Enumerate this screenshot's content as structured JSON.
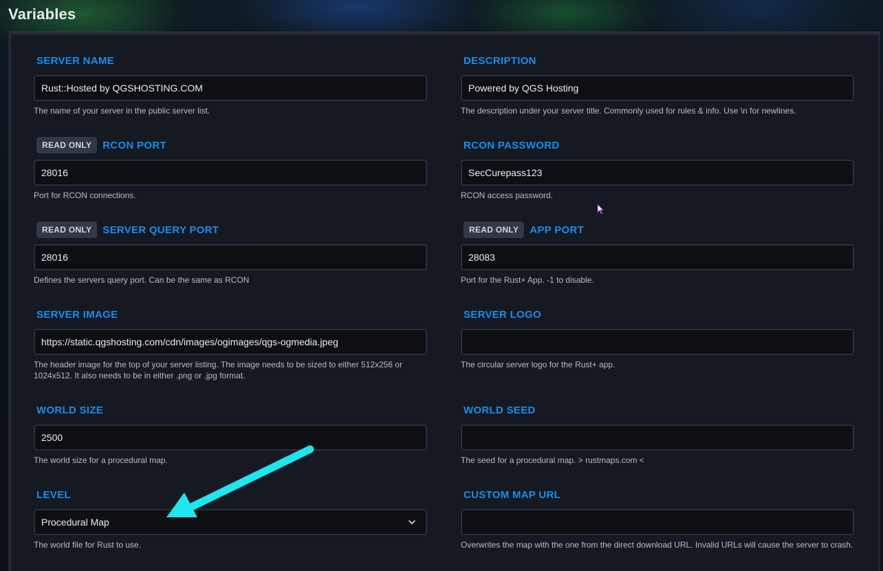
{
  "page": {
    "title": "Variables"
  },
  "accent_color": "#1c8cec",
  "annotation_color": "#1ee6ee",
  "badge_label": "READ ONLY",
  "fields": {
    "server_name": {
      "label": "SERVER NAME",
      "value": "Rust::Hosted by QGSHOSTING.COM",
      "description": "The name of your server in the public server list."
    },
    "description": {
      "label": "DESCRIPTION",
      "value": "Powered by QGS Hosting",
      "description": "The description under your server title. Commonly used for rules & info. Use \\n for newlines."
    },
    "rcon_port": {
      "label": "RCON PORT",
      "value": "28016",
      "description": "Port for RCON connections."
    },
    "rcon_password": {
      "label": "RCON PASSWORD",
      "value": "SecCurepass123",
      "description": "RCON access password."
    },
    "server_query_port": {
      "label": "SERVER QUERY PORT",
      "value": "28016",
      "description": "Defines the servers query port. Can be the same as RCON"
    },
    "app_port": {
      "label": "APP PORT",
      "value": "28083",
      "description": "Port for the Rust+ App. -1 to disable."
    },
    "server_image": {
      "label": "SERVER IMAGE",
      "value": "https://static.qgshosting.com/cdn/images/ogimages/qgs-ogmedia.jpeg",
      "description": "The header image for the top of your server listing. The image needs to be sized to either 512x256 or 1024x512. It also needs to be in either .png or .jpg format."
    },
    "server_logo": {
      "label": "SERVER LOGO",
      "value": "",
      "description": "The circular server logo for the Rust+ app."
    },
    "world_size": {
      "label": "WORLD SIZE",
      "value": "2500",
      "description": "The world size for a procedural map."
    },
    "world_seed": {
      "label": "WORLD SEED",
      "value": "",
      "description": "The seed for a procedural map. > rustmaps.com <"
    },
    "level": {
      "label": "LEVEL",
      "value": "Procedural Map",
      "description": "The world file for Rust to use.",
      "icon": "chevron-down-icon"
    },
    "custom_map_url": {
      "label": "CUSTOM MAP URL",
      "value": "",
      "description": "Overwrites the map with the one from the direct download URL. Invalid URLs will cause the server to crash."
    }
  }
}
